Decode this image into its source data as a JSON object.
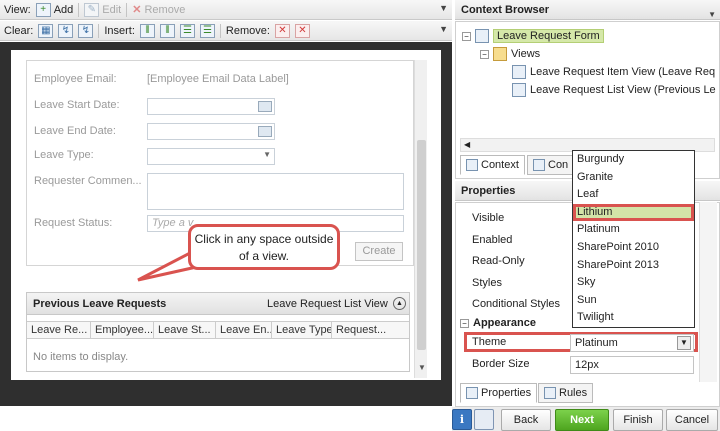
{
  "toolbar1": {
    "view_label": "View:",
    "add_label": "Add",
    "edit_label": "Edit",
    "remove_label": "Remove"
  },
  "toolbar2": {
    "clear_label": "Clear:",
    "insert_label": "Insert:",
    "remove_label": "Remove:"
  },
  "form": {
    "fields": [
      {
        "label": "Employee Email:",
        "value": "[Employee Email Data Label]"
      },
      {
        "label": "Leave Start Date:"
      },
      {
        "label": "Leave End Date:"
      },
      {
        "label": "Leave Type:"
      },
      {
        "label": "Requester Commen..."
      },
      {
        "label": "Request Status:",
        "placeholder": "Type a v"
      }
    ],
    "create_label": "Create"
  },
  "callout": {
    "text": "Click in any space outside of a view."
  },
  "list_view": {
    "title": "Previous Leave Requests",
    "view_name": "Leave Request List View",
    "columns": [
      "Leave Re...",
      "Employee...",
      "Leave St...",
      "Leave En...",
      "Leave Type",
      "Request..."
    ],
    "empty_text": "No items to display."
  },
  "context_browser": {
    "title": "Context Browser",
    "root": "Leave Request Form",
    "views_folder": "Views",
    "items": [
      "Leave Request Item View (Leave Req",
      "Leave Request List View (Previous Le"
    ],
    "tabs": [
      "Context",
      "Con"
    ]
  },
  "properties": {
    "title": "Properties",
    "labels": [
      "Visible",
      "Enabled",
      "Read-Only",
      "Styles",
      "Conditional Styles"
    ],
    "section": "Appearance",
    "theme_label": "Theme",
    "theme_value": "Platinum",
    "border_label": "Border Size",
    "border_value": "12px",
    "tabs": [
      "Properties",
      "Rules"
    ]
  },
  "theme_options": [
    "Burgundy",
    "Granite",
    "Leaf",
    "Lithium",
    "Platinum",
    "SharePoint 2010",
    "SharePoint 2013",
    "Sky",
    "Sun",
    "Twilight"
  ],
  "highlighted_option": "Lithium",
  "buttons": {
    "back": "Back",
    "next": "Next",
    "finish": "Finish",
    "cancel": "Cancel"
  },
  "colors": {
    "highlight_red": "#d9534f",
    "next_green": "#5cb82e",
    "selected_green": "#d3e4a8"
  }
}
